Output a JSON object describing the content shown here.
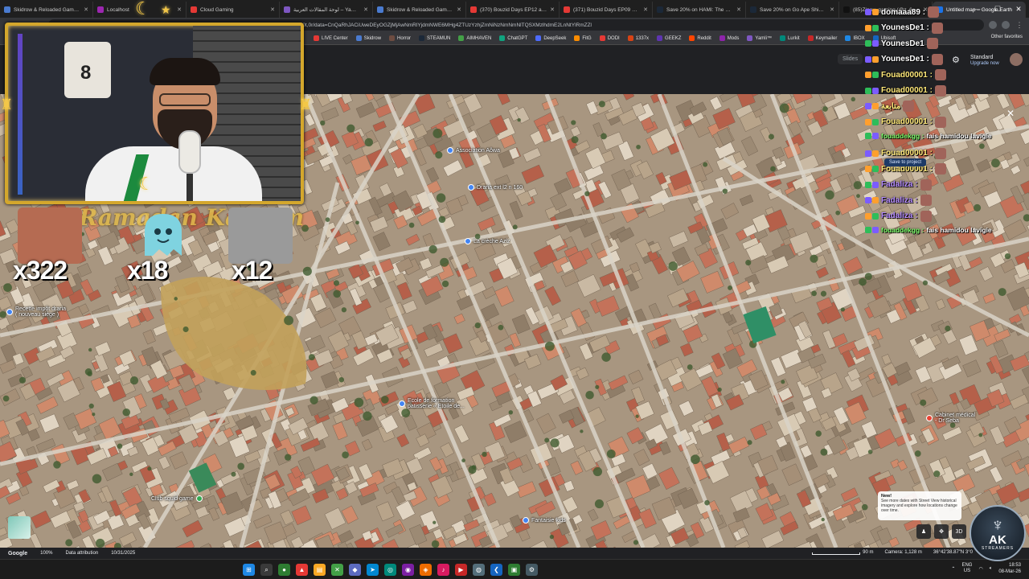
{
  "browser": {
    "tabs": [
      {
        "title": "Skidrow & Reloaded Games – Do",
        "color": "#4a7bd0"
      },
      {
        "title": "Localhost",
        "color": "#9c27b0"
      },
      {
        "title": "Cloud Gaming",
        "color": "#e53935"
      },
      {
        "title": "لوحة المقالات العربية – Yamli محرر",
        "color": "#7e57c2"
      },
      {
        "title": "Skidrow & Reloaded Games – Do",
        "color": "#4a7bd0"
      },
      {
        "title": "(370) Bouzid Days EP12 analysis",
        "color": "#e53935"
      },
      {
        "title": "(371) Bouzid Days EP09 Doctour",
        "color": "#e53935"
      },
      {
        "title": "Save 20% on HAMI: The Game on",
        "color": "#1b2838"
      },
      {
        "title": "Save 20% on Go Ape Ship! on St",
        "color": "#1b2838"
      },
      {
        "title": "(85)Zinou_gaming (@z_6_r3) | Ti",
        "color": "#111111"
      },
      {
        "title": "Untitled map – Google Earth",
        "color": "#1a73e8",
        "active": true
      }
    ],
    "address": "earth.google.com/web/search/Draria+Draria,+Alger/@36.7198,3.0213,955.27134005d,35y,200.13277151h,0t,0r/data=CnQaRhJACiUweDEyOGZjMjAwNmRlYjdmNWE6MHg4ZTUzYzhjZmNiNzNmNmNlTQSXMzlhdmE2LnNtYlRmZZl",
    "bookmarks": [
      {
        "label": "LIVE Center",
        "color": "#e53935"
      },
      {
        "label": "Skidrow",
        "color": "#4a7bd0"
      },
      {
        "label": "Horror",
        "color": "#6d4c41"
      },
      {
        "label": "STEAMUN",
        "color": "#1b2838"
      },
      {
        "label": "AIMHAVEN",
        "color": "#43a047"
      },
      {
        "label": "ChatGPT",
        "color": "#10a37f"
      },
      {
        "label": "DeepSeek",
        "color": "#4d6bfe"
      },
      {
        "label": "FitG",
        "color": "#fb8c00"
      },
      {
        "label": "DODI",
        "color": "#e53935"
      },
      {
        "label": "1337x",
        "color": "#d84315"
      },
      {
        "label": "GEEKZ",
        "color": "#5e35b1"
      },
      {
        "label": "Reddit",
        "color": "#ff4500"
      },
      {
        "label": "Mods",
        "color": "#8e24aa"
      },
      {
        "label": "Yamli™",
        "color": "#7e57c2"
      },
      {
        "label": "Lurkit",
        "color": "#00897b"
      },
      {
        "label": "Keymailer",
        "color": "#c62828"
      },
      {
        "label": "IBOX",
        "color": "#1e88e5"
      },
      {
        "label": "Ubisoft",
        "color": "#1565c0"
      }
    ],
    "other_bookmarks": "Other favorites"
  },
  "earth": {
    "slides_label": "Slides",
    "plan_label": "Standard",
    "upgrade_label": "Upgrade now",
    "save_to_project": "Save to project",
    "pois": [
      {
        "label": "Association Aôwa",
        "color": "#4285f4"
      },
      {
        "label": "Draria ext l2 n 160",
        "color": "#4285f4"
      },
      {
        "label": "La crèche Aziz",
        "color": "#4285f4"
      },
      {
        "label": "Recette impôt draria\n( nouveau siège )",
        "color": "#4285f4"
      },
      {
        "label": "Ecole de formation\npatisserie « Etoile de...",
        "color": "#4285f4"
      },
      {
        "label": "Club squid game",
        "color": "#34a853"
      },
      {
        "label": "Fantaisie kids",
        "color": "#4285f4"
      },
      {
        "label": "Cabinet médical\n- Dr Seba",
        "color": "#ea4335"
      }
    ],
    "notice_title": "New!",
    "notice_body": "See more dates with Street View historical imagery and explore how locations change over time.",
    "status": {
      "logo": "Google",
      "zoom": "100%",
      "attribution": "Data attribution",
      "date": "10/31/2025",
      "scale": "90 m",
      "camera": "Camera: 1,128 m",
      "coords": "36°42'38.87\"N 3°0"
    }
  },
  "stream": {
    "jersey_number": "8",
    "ramadan_text": "Ramadan Kareem",
    "emotes": [
      {
        "count": "x322",
        "color": "#b56b52"
      },
      {
        "count": "x18",
        "color": "#7fd3e0"
      },
      {
        "count": "x12",
        "color": "#555555"
      }
    ],
    "chat": [
      {
        "user": "domaaa89 :",
        "style": "",
        "msg": ""
      },
      {
        "user": "YounesDe1 :",
        "style": "",
        "msg": ""
      },
      {
        "user": "YounesDe1",
        "style": "",
        "msg": ""
      },
      {
        "user": "YounesDe1 :",
        "style": "",
        "msg": ""
      },
      {
        "user": "Fouad00001 :",
        "style": "",
        "msg": ""
      },
      {
        "user": "Fouad00001 :",
        "style": "",
        "msg": ""
      },
      {
        "user": "متابعة",
        "style": "",
        "msg": ""
      },
      {
        "user": "Fouad00001 :",
        "style": "",
        "msg": ""
      },
      {
        "user": "fouaddekgg :",
        "style": "green",
        "msg": "fais hamidou lavigie"
      },
      {
        "user": "Fouad00001 :",
        "style": "",
        "msg": ""
      },
      {
        "user": "Fouad00001 :",
        "style": "",
        "msg": ""
      },
      {
        "user": "Fadaliza :",
        "style": "purple",
        "msg": ""
      },
      {
        "user": "Fadaliza :",
        "style": "purple",
        "msg": ""
      },
      {
        "user": "Fadaliza :",
        "style": "purple",
        "msg": ""
      },
      {
        "user": "fouaddekgg :",
        "style": "green",
        "msg": "fais hamidou lavigie"
      }
    ],
    "logo": {
      "top": "AK",
      "bottom": "STREAMERS"
    }
  },
  "taskbar": {
    "lang_top": "ENG",
    "lang_bottom": "US",
    "time": "18:53",
    "date": "08-Mar-26"
  }
}
